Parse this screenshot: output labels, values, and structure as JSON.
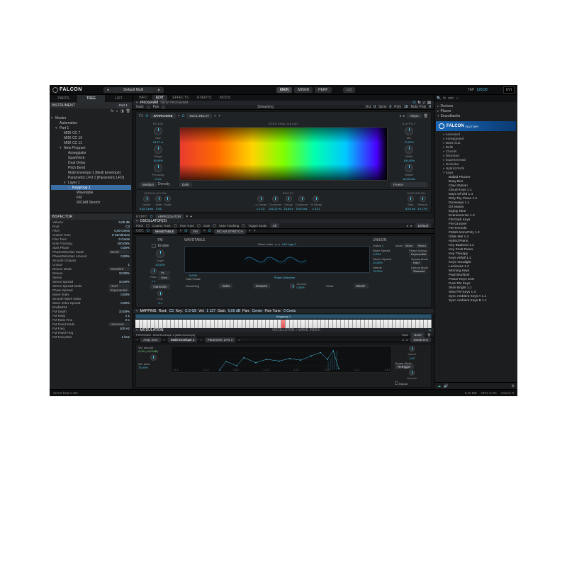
{
  "titlebar": {
    "logo": "FALCON",
    "preset": "Default Multi",
    "main": "MAIN",
    "mixer": "MIXER",
    "perf": "PERF",
    "tap": "TAP",
    "tempo": "120,00",
    "brand": "UVI"
  },
  "left": {
    "tabs": {
      "parts": "PARTS",
      "tree": "TREE",
      "list": "LIST"
    },
    "instrument_hdr": "INSTRUMENT",
    "part_sel": "Part 1",
    "tree": [
      {
        "l": 0,
        "t": "Master",
        "exp": true
      },
      {
        "l": 1,
        "t": "Automation"
      },
      {
        "l": 1,
        "t": "Part 1",
        "exp": true
      },
      {
        "l": 2,
        "t": "MIDI CC 7"
      },
      {
        "l": 2,
        "t": "MIDI CC 10"
      },
      {
        "l": 2,
        "t": "MIDI CC 11"
      },
      {
        "l": 2,
        "t": "New Program",
        "exp": true
      },
      {
        "l": 3,
        "t": "Arpeggiator"
      },
      {
        "l": 3,
        "t": "SparkVerb"
      },
      {
        "l": 3,
        "t": "Dual Delay"
      },
      {
        "l": 3,
        "t": "Pitch Bend"
      },
      {
        "l": 3,
        "t": "Multi Envelope 1 [Multi Envelope]"
      },
      {
        "l": 3,
        "t": "Parametric LFO 1 [Parametric LFO]"
      },
      {
        "l": 3,
        "t": "Layer 1",
        "exp": true
      },
      {
        "l": 4,
        "t": "Keygroup 1",
        "exp": true,
        "sel": true
      },
      {
        "l": 5,
        "t": "Wavetable"
      },
      {
        "l": 5,
        "t": "FM"
      },
      {
        "l": 5,
        "t": "IRCAM Stretch"
      }
    ],
    "inspector_hdr": "INSPECTOR",
    "inspector": [
      {
        "k": "Volume",
        "v": "0,00 dB"
      },
      {
        "k": "Root",
        "v": "C3"
      },
      {
        "k": "Pitch",
        "v": "0,00 Cents"
      },
      {
        "k": "Coarse Tune",
        "v": "0 Semitones"
      },
      {
        "k": "Fine Tune",
        "v": "0 Cents"
      },
      {
        "k": "Note Tracking",
        "v": "100,00%"
      },
      {
        "k": "Start Phase",
        "v": "0,00%"
      },
      {
        "k": "PhaseDistortion Mode",
        "v": "Bend+",
        "dd": true
      },
      {
        "k": "PhaseDistortion Amount",
        "v": "0,00%"
      },
      {
        "k": "Smooth Octaves",
        "v": ""
      },
      {
        "k": "Unison",
        "v": "1"
      },
      {
        "k": "Detune Mode",
        "v": "Standard",
        "dd": true
      },
      {
        "k": "Detune",
        "v": "10,00%"
      },
      {
        "k": "Stereo",
        "v": ""
      },
      {
        "k": "Stereo Spread",
        "v": "10,00%"
      },
      {
        "k": "Stereo Spread Mode",
        "v": "Hard",
        "dd": true
      },
      {
        "k": "Phase Spread",
        "v": "Exponential",
        "dd": true
      },
      {
        "k": "Wave Index",
        "v": "0,00%"
      },
      {
        "k": "Smooth Wave Index",
        "v": ""
      },
      {
        "k": "Wave Index Spread",
        "v": "0,00%"
      },
      {
        "k": "EnableFM",
        "v": ""
      },
      {
        "k": "FM Depth",
        "v": "10,00%"
      },
      {
        "k": "FM Ratio",
        "v": "x 1"
      },
      {
        "k": "FM Ratio Fine",
        "v": "0 c"
      },
      {
        "k": "FM Fixed Mode",
        "v": "Harmonic",
        "dd": true
      },
      {
        "k": "FM Freq",
        "v": "100 Hz"
      },
      {
        "k": "FM Fixed Freq",
        "v": ""
      },
      {
        "k": "FM Freq Mult",
        "v": "1 kHz"
      }
    ]
  },
  "center": {
    "tabs": {
      "info": "INFO",
      "edit": "EDIT",
      "effects": "EFFECTS",
      "events": "EVENTS",
      "mods": "MODS"
    },
    "program_hdr": "PROGRAM",
    "program_name": "NEW PROGRAM",
    "prog_strip": {
      "gain": "Gain",
      "pan": "Pan",
      "streaming": "Streaming",
      "oct": "Oct",
      "oct_v": "0",
      "semi": "Semi",
      "semi_v": "0",
      "poly": "Poly",
      "poly_v": "16",
      "notepoly": "Note Poly",
      "notepoly_v": "0"
    },
    "fx": {
      "label": "FX",
      "tabs": [
        "SPARKVERB",
        "DUAL DELAY"
      ],
      "preset": "Abyss",
      "room": {
        "lbl": "ROOM",
        "size": {
          "l": "Size",
          "v": "29,27 m"
        },
        "shape": {
          "l": "Shape",
          "v": "15,00%"
        },
        "predelay": {
          "l": "Pre-delay",
          "v": "0 ms"
        },
        "medium": "Medium",
        "density": "Density"
      },
      "spectral_lbl": "SPECTRAL DECAY",
      "dark": "Dark",
      "output": {
        "lbl": "OUTPUT",
        "mix": {
          "l": "Mix",
          "v": "70,00%"
        },
        "width": {
          "l": "Width",
          "v": "100,00%"
        },
        "rolloff": {
          "l": "Rolloff",
          "v": "10,09 kHz"
        },
        "freeze": "Freeze"
      },
      "mod": {
        "modulation": {
          "lbl": "MODULATION",
          "knobs": [
            {
              "l": "Depth",
              "v": "6,64 Cents"
            },
            {
              "l": "Rate",
              "v": "0,56"
            },
            {
              "l": "Mode",
              "v": ""
            }
          ]
        },
        "decay": {
          "lbl": "DECAY",
          "knobs": [
            {
              "l": "Lo Decay",
              "v": "x 2,13"
            },
            {
              "l": "Crossover",
              "v": "205,12 Hz"
            },
            {
              "l": "Decay",
              "v": "15,65 s"
            },
            {
              "l": "Crossover",
              "v": "5,90 kHz"
            },
            {
              "l": "Hi Decay",
              "v": "x 0,21"
            }
          ]
        },
        "diffusion": {
          "lbl": "DIFFUSION",
          "knobs": [
            {
              "l": "Start",
              "v": "8,93 ms"
            },
            {
              "l": "Amount",
              "v": "19,17%"
            }
          ]
        }
      }
    },
    "arp_hdr": "ARPEGGIATOR",
    "osc": {
      "hdr": "OSCILLATOR(S)",
      "strip": {
        "pitch": "Pitch",
        "coarse": "Coarse Tune",
        "fine": "Fine Tune",
        "gain": "Gain",
        "notetrack": "Note Tracking",
        "trigmode": "Trigger Mode",
        "trigval": "All"
      },
      "default": "Default",
      "tabs": [
        "WAVETABLE",
        "FM",
        "IRCAM STRETCH"
      ],
      "fm": {
        "lbl": "FM",
        "enable": "Enable",
        "depth": {
          "l": "Depth",
          "v": "10,00%"
        },
        "ratio": {
          "l": "Ratio",
          "v": "x 1"
        },
        "hz": "Hz",
        "fixed": "Fixed",
        "harmonic": "Harmonic",
        "fine": {
          "l": "Fine",
          "v": "0 c"
        }
      },
      "wt": {
        "lbl": "WAVETABLE",
        "waveidx": "Wave Index",
        "waveidx_v": "0,00%",
        "startphase": "Start Phase",
        "preset": "UVI Logo 2",
        "phasedist": "Phase Distortion",
        "smoothing": "Smoothing",
        "index": "Index",
        "octaves": "Octaves",
        "amount": {
          "l": "Amount",
          "v": "0,00%"
        },
        "mode": "Mode",
        "mode_v": "Bend+"
      },
      "unison": {
        "lbl": "UNISON",
        "voices": {
          "l": "Voices",
          "v": "1"
        },
        "mode": {
          "l": "Mode",
          "v": "Mono",
          "alt": "Stereo"
        },
        "wavespread": {
          "l": "Wave Spread",
          "v": "0,00%"
        },
        "phasespread": {
          "l": "Phase Spread",
          "v": "Exponential"
        },
        "stereospread": {
          "l": "Stereo Spread",
          "v": "10,00%"
        },
        "spreadmode": {
          "l": "Spread Mode",
          "v": "Hard"
        },
        "detune": {
          "l": "Detune",
          "v": "10,00%"
        },
        "detunemode": {
          "l": "Detune Mode",
          "v": "Standard"
        }
      }
    },
    "mapping": {
      "hdr": "MAPPING",
      "root": "Root:",
      "root_v": "C3",
      "key": "Key:",
      "key_v": "C-2 G8",
      "vel": "Vel:",
      "vel_v": "1 127",
      "gain": "Gain:",
      "gain_v": "0,00 dB",
      "pan": "Pan:",
      "pan_v": "Center",
      "ft": "Fine Tune:",
      "ft_v": "0 Cents",
      "keygroup": "Keygroup 1"
    },
    "modulation": {
      "hdr": "MODULATION",
      "target": "OSCILLATOR > WAVE INDEX",
      "prog": "PROGRAM : Multi Envelope 1 [Multi Envelope]",
      "sub": "SUB:",
      "sub_v": "None",
      "tabs": [
        "Amp. Env.",
        "Multi Envelope 1",
        "Parametric LFO 1"
      ],
      "velamt": {
        "l": "Vel. amount",
        "v": "0,0% (+6,02dB)"
      },
      "velsens": {
        "l": "Vel. sens",
        "v": "75,00%"
      },
      "steps": [
        "1.1.1",
        "1.1.3",
        "1.2.1",
        "1.2.3",
        "1.3.1",
        "1.3.3",
        "1.4.1",
        "1.4.3"
      ],
      "steak": "Steak Env",
      "speed": {
        "l": "Speed",
        "v": "1,00"
      },
      "trigmode": {
        "l": "Trigger Mode",
        "v": "Retrigger"
      },
      "smooth": {
        "l": "Smooth",
        "v": ""
      },
      "bipolar": "Bipolar"
    }
  },
  "right": {
    "tabs": {
      "devices": "Devices",
      "places": "Places",
      "soundbanks": "Soundbanks"
    },
    "banner": "FALCON",
    "banner_sub": "FACTORY",
    "folders": [
      "Animated",
      "Arpeggiated",
      "Bass-Sub",
      "Bells",
      "Chords",
      "Distorted",
      "Experimental",
      "Granular",
      "Hybrid Perfs",
      "Keys"
    ],
    "keys_items": [
      "Ballad Plucker",
      "Busy Bee",
      "Clavi Station",
      "Cloud Keys 1.1",
      "Days Of Old 1.4",
      "Dirty Toy Piano 1.2",
      "Doorways 1.1",
      "DX Mania",
      "Eighty Nine",
      "Evanescense 1.2",
      "FM Dark Keys",
      "FM Groover",
      "FM Tremolo",
      "FMish MonoPoly 1.2",
      "Glide Mel 1.4",
      "Hybrid Piano",
      "Key Battered 1.2",
      "Key Frost Piano",
      "Key Therapy",
      "Keys Airfall 1.1",
      "Keys Vocalight",
      "Luminous 1.2",
      "Morning Keys",
      "Paul Wurlitzer",
      "Power Keys SnH",
      "Pure FM Keys",
      "Slide Bright 1.1",
      "Step FM Keys 1.4",
      "Sync Ambient Keys A 1.1",
      "Sync Ambient Keys B 1.1"
    ]
  },
  "status": {
    "version": "v2.0.0-beta.1 x64",
    "mem": "0,10 MB",
    "cpu": "CPU: 0.3%",
    "voices": "Voices: 0"
  }
}
